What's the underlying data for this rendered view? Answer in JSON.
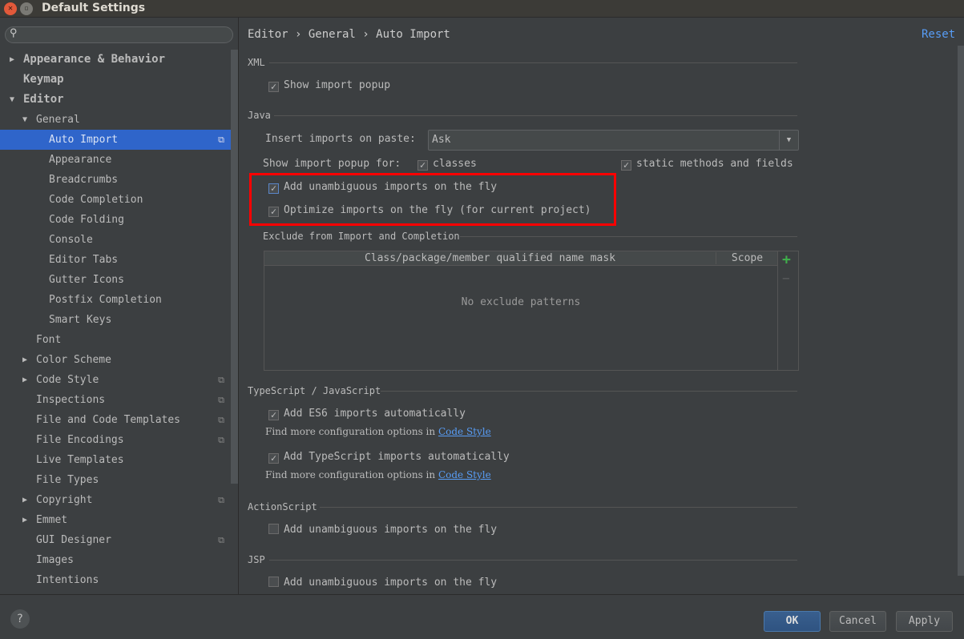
{
  "window": {
    "title": "Default Settings"
  },
  "sidebar": {
    "items": [
      {
        "label": "Appearance & Behavior",
        "level": 0,
        "arrow": "right",
        "bold": true
      },
      {
        "label": "Keymap",
        "level": 0,
        "arrow": "",
        "bold": true
      },
      {
        "label": "Editor",
        "level": 0,
        "arrow": "down",
        "bold": true
      },
      {
        "label": "General",
        "level": 1,
        "arrow": "down"
      },
      {
        "label": "Auto Import",
        "level": 2,
        "selected": true,
        "copy": true
      },
      {
        "label": "Appearance",
        "level": 2
      },
      {
        "label": "Breadcrumbs",
        "level": 2
      },
      {
        "label": "Code Completion",
        "level": 2
      },
      {
        "label": "Code Folding",
        "level": 2
      },
      {
        "label": "Console",
        "level": 2
      },
      {
        "label": "Editor Tabs",
        "level": 2
      },
      {
        "label": "Gutter Icons",
        "level": 2
      },
      {
        "label": "Postfix Completion",
        "level": 2
      },
      {
        "label": "Smart Keys",
        "level": 2
      },
      {
        "label": "Font",
        "level": 1
      },
      {
        "label": "Color Scheme",
        "level": 1,
        "arrow": "right"
      },
      {
        "label": "Code Style",
        "level": 1,
        "arrow": "right",
        "copy": true
      },
      {
        "label": "Inspections",
        "level": 1,
        "copy": true
      },
      {
        "label": "File and Code Templates",
        "level": 1,
        "copy": true
      },
      {
        "label": "File Encodings",
        "level": 1,
        "copy": true
      },
      {
        "label": "Live Templates",
        "level": 1
      },
      {
        "label": "File Types",
        "level": 1
      },
      {
        "label": "Copyright",
        "level": 1,
        "arrow": "right",
        "copy": true
      },
      {
        "label": "Emmet",
        "level": 1,
        "arrow": "right"
      },
      {
        "label": "GUI Designer",
        "level": 1,
        "copy": true
      },
      {
        "label": "Images",
        "level": 1
      },
      {
        "label": "Intentions",
        "level": 1
      }
    ]
  },
  "main": {
    "breadcrumb": "Editor › General › Auto Import",
    "reset": "Reset",
    "xml": {
      "header": "XML",
      "show_popup": "Show import popup",
      "show_popup_checked": true
    },
    "java": {
      "header": "Java",
      "insert_label": "Insert imports on paste:",
      "insert_value": "Ask",
      "popup_for": "Show import popup for:",
      "classes": "classes",
      "classes_checked": true,
      "static": "static methods and fields",
      "static_checked": true,
      "add_unambiguous": "Add unambiguous imports on the fly",
      "add_unambiguous_checked": true,
      "optimize": "Optimize imports on the fly (for current project)",
      "optimize_checked": true,
      "highlight_color": "#ff0000"
    },
    "exclude": {
      "header": "Exclude from Import and Completion",
      "col1": "Class/package/member qualified name mask",
      "col2": "Scope",
      "empty": "No exclude patterns",
      "add": "+",
      "remove": "−"
    },
    "ts": {
      "header": "TypeScript / JavaScript",
      "es6": "Add ES6 imports automatically",
      "es6_checked": true,
      "find1": "Find more configuration options in",
      "link1": "Code Style",
      "tsimp": "Add TypeScript imports automatically",
      "tsimp_checked": true,
      "find2": "Find more configuration options in",
      "link2": "Code Style"
    },
    "as": {
      "header": "ActionScript",
      "add": "Add unambiguous imports on the fly",
      "checked": false
    },
    "jsp": {
      "header": "JSP",
      "add": "Add unambiguous imports on the fly",
      "checked": false
    }
  },
  "footer": {
    "help": "?",
    "ok": "OK",
    "cancel": "Cancel",
    "apply": "Apply"
  }
}
